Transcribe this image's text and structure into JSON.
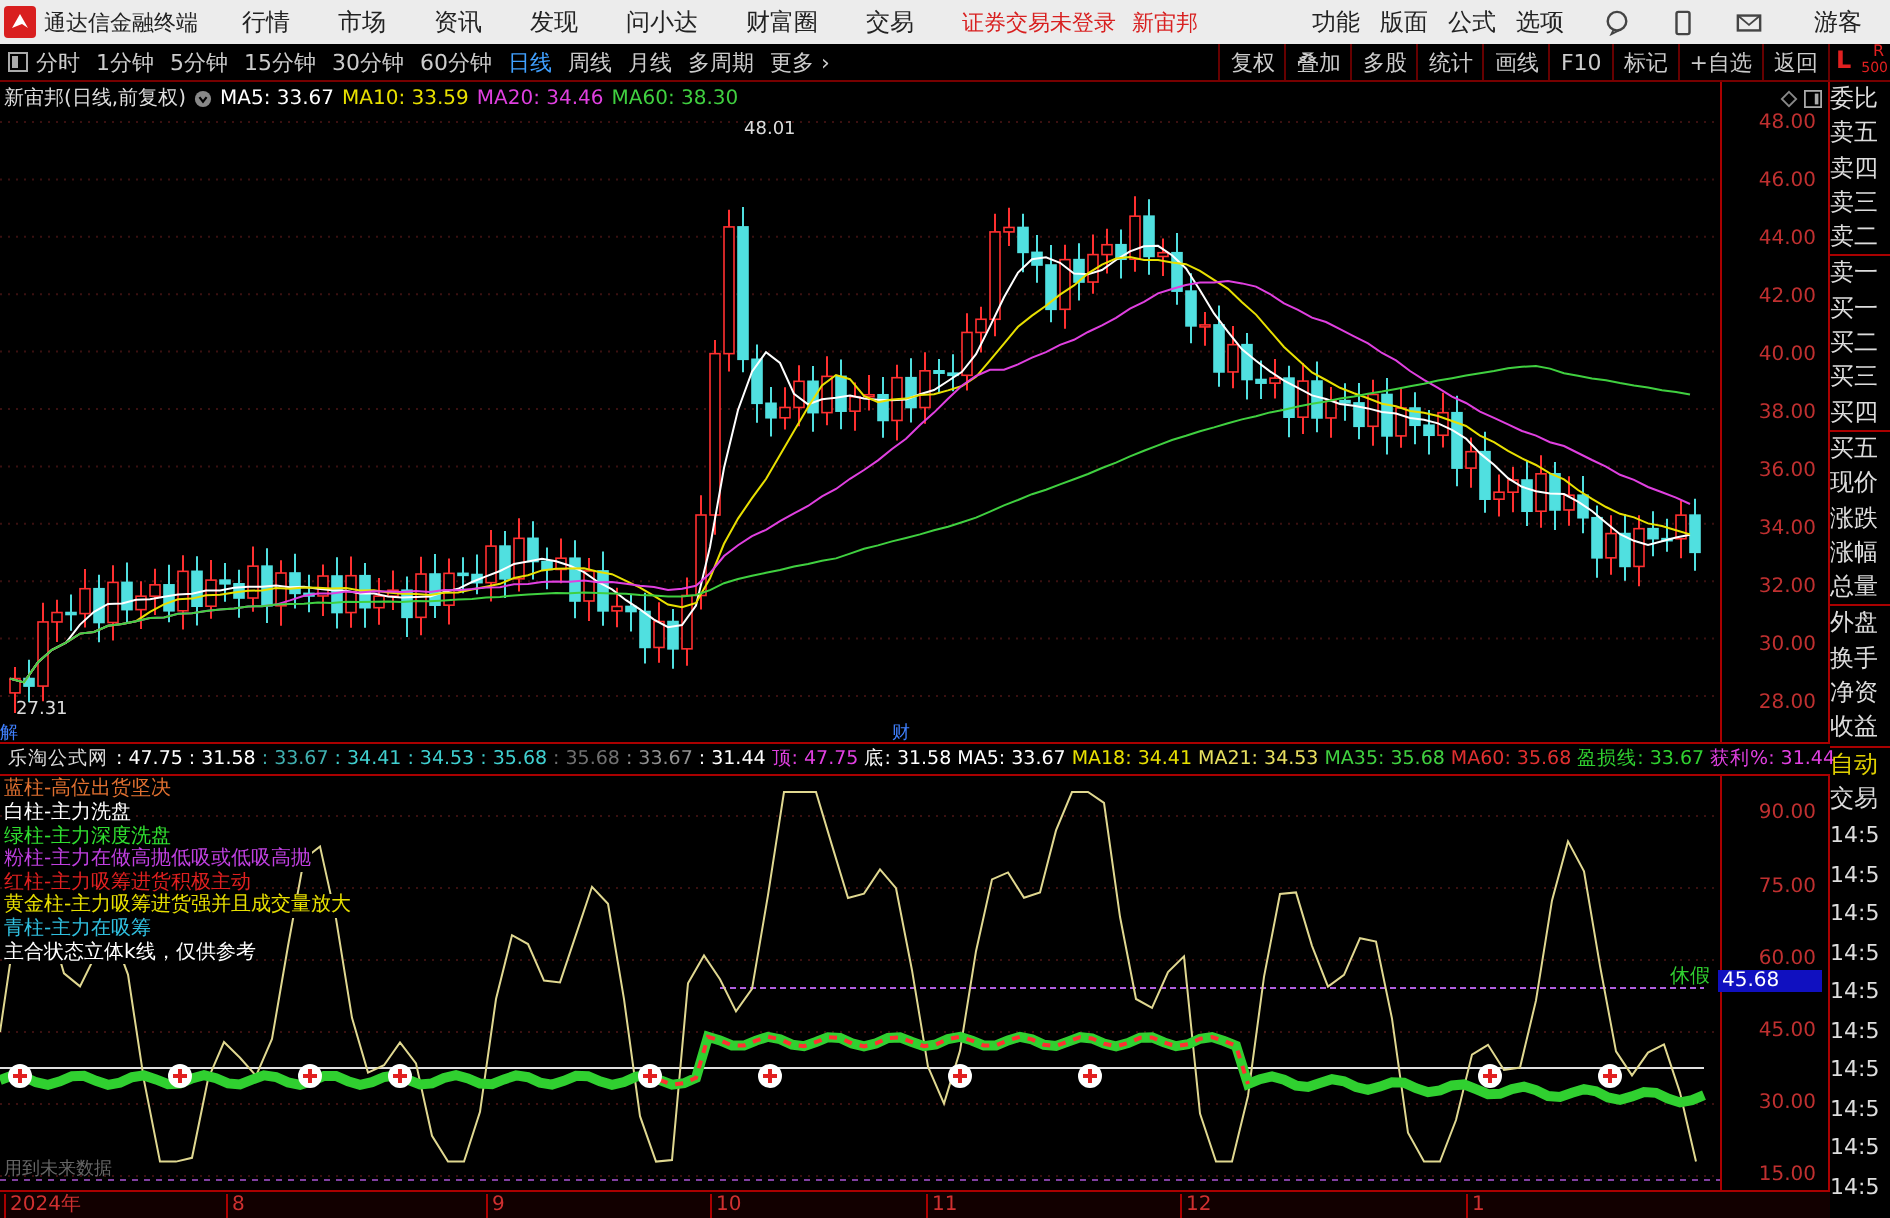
{
  "menubar": {
    "app_title": "通达信金融终端",
    "menus": [
      "行情",
      "市场",
      "资讯",
      "发现",
      "问小达",
      "财富圈",
      "交易"
    ],
    "notice": "证券交易未登录",
    "stock": "新宙邦",
    "right_menus": [
      "功能",
      "版面",
      "公式",
      "选项"
    ],
    "user": "游客"
  },
  "toolbar": {
    "periods": [
      {
        "label": "分时",
        "selected": false
      },
      {
        "label": "1分钟",
        "selected": false
      },
      {
        "label": "5分钟",
        "selected": false
      },
      {
        "label": "15分钟",
        "selected": false
      },
      {
        "label": "30分钟",
        "selected": false
      },
      {
        "label": "60分钟",
        "selected": false
      },
      {
        "label": "日线",
        "selected": true
      },
      {
        "label": "周线",
        "selected": false
      },
      {
        "label": "月线",
        "selected": false
      },
      {
        "label": "多周期",
        "selected": false
      }
    ],
    "more": "更多 ›",
    "actions": [
      "复权",
      "叠加",
      "多股",
      "统计",
      "画线",
      "F10",
      "标记",
      "+自选",
      "返回"
    ]
  },
  "price_chart": {
    "title": "新宙邦(日线,前复权)",
    "mas": [
      {
        "label": "MA5: 33.67",
        "color": "#ffffff"
      },
      {
        "label": "MA10: 33.59",
        "color": "#e8e000"
      },
      {
        "label": "MA20: 34.46",
        "color": "#e040e0"
      },
      {
        "label": "MA60: 38.30",
        "color": "#40d040"
      }
    ],
    "axis": [
      "48.00",
      "46.00",
      "44.00",
      "42.00",
      "40.00",
      "38.00",
      "36.00",
      "34.00",
      "32.00",
      "30.00",
      "28.00"
    ],
    "high_label": "48.01",
    "low_label": "27.31",
    "markers": [
      "解",
      "财"
    ]
  },
  "indicator": {
    "name": "乐淘公式网",
    "values": [
      {
        "text": ": 47.75",
        "color": "#ffffff"
      },
      {
        "text": ": 31.58",
        "color": "#ffffff"
      },
      {
        "text": ": 33.67",
        "color": "#40b0b0"
      },
      {
        "text": ": 34.41",
        "color": "#40d0d0"
      },
      {
        "text": ": 34.53",
        "color": "#40d0d0"
      },
      {
        "text": ": 35.68",
        "color": "#40d0d0"
      },
      {
        "text": ": 35.68",
        "color": "#707070"
      },
      {
        "text": ": 33.67",
        "color": "#909090"
      },
      {
        "text": ": 31.44",
        "color": "#ffffff"
      },
      {
        "text": "顶: 47.75",
        "color": "#e040e0"
      },
      {
        "text": "底: 31.58",
        "color": "#ffffff"
      },
      {
        "text": "MA5: 33.67",
        "color": "#ffffff"
      },
      {
        "text": "MA18: 34.41",
        "color": "#e8e000"
      },
      {
        "text": "MA21: 34.53",
        "color": "#e8e060"
      },
      {
        "text": "MA35: 35.68",
        "color": "#40d040"
      },
      {
        "text": "MA60: 35.68",
        "color": "#e03030"
      },
      {
        "text": "盈损线: 33.67",
        "color": "#30d030"
      },
      {
        "text": "获利%: 31.44",
        "color": "#e040e0"
      }
    ],
    "legend": [
      {
        "text": "蓝柱-高位出货坚决",
        "color": "#e07030"
      },
      {
        "text": "白柱-主力洗盘",
        "color": "#ffffff"
      },
      {
        "text": "绿柱-主力深度洗盘",
        "color": "#30e030"
      },
      {
        "text": "粉柱-主力在做高抛低吸或低吸高抛",
        "color": "#c040e0"
      },
      {
        "text": "红柱-主力吸筹进货积极主动",
        "color": "#e02020"
      },
      {
        "text": "黄金柱-主力吸筹进货强并且成交量放大",
        "color": "#e8e000"
      },
      {
        "text": "青柱-主力在吸筹",
        "color": "#30c0e0"
      },
      {
        "text": "主合状态立体k线，仅供参考",
        "color": "#ffffff"
      }
    ],
    "axis": [
      "90.00",
      "75.00",
      "60.00",
      "45.00",
      "30.00",
      "15.00"
    ],
    "badge": "45.68",
    "tag": "休假",
    "footer": "用到未来数据"
  },
  "x_axis": [
    "2024年",
    "8",
    "9",
    "10",
    "11",
    "12",
    "1"
  ],
  "quote_panel": {
    "corner": "L",
    "corner_sub": "R",
    "corner_num": "500",
    "labels": [
      "委比",
      "卖五",
      "卖四",
      "卖三",
      "卖二",
      "卖一",
      "买一",
      "买二",
      "买三",
      "买四",
      "买五",
      "现价",
      "涨跌",
      "涨幅",
      "总量",
      "外盘",
      "换手",
      "净资",
      "收益"
    ],
    "auto": "自动",
    "trade": "交易",
    "times": [
      "14:5",
      "14:5",
      "14:5",
      "14:5",
      "14:5",
      "14:5",
      "14:5",
      "14:5",
      "14:5",
      "14:5"
    ]
  }
}
